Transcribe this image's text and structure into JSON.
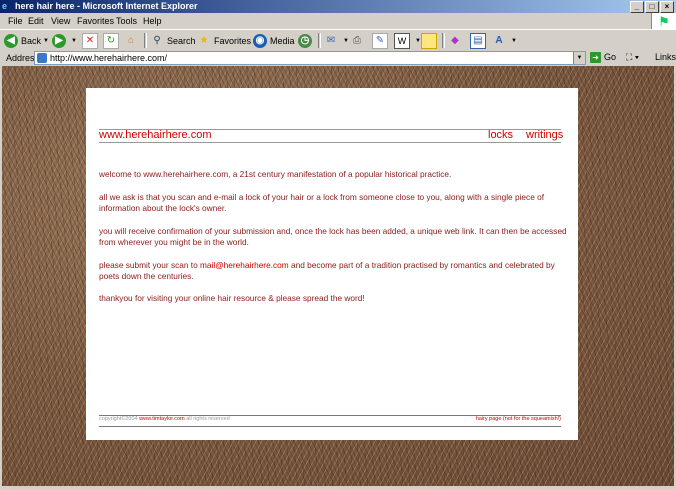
{
  "window": {
    "title": "here hair here - Microsoft Internet Explorer",
    "controls": [
      "_",
      "□",
      "×"
    ]
  },
  "menu": {
    "items": [
      "File",
      "Edit",
      "View",
      "Favorites",
      "Tools",
      "Help"
    ]
  },
  "toolbar": {
    "back_label": "Back",
    "search_label": "Search",
    "favorites_label": "Favorites",
    "media_label": "Media"
  },
  "address": {
    "label": "Address",
    "value": "http://www.herehairhere.com/",
    "go_label": "Go",
    "links_label": "Links"
  },
  "site": {
    "name": "www.herehairhere.com",
    "nav": [
      "locks",
      "writings"
    ],
    "paragraphs": {
      "p1": "welcome to www.herehairhere.com, a 21st century manifestation of a popular historical practice.",
      "p2": "all we ask is that you scan and e-mail a lock of your hair or a lock from someone close to you, along with a single piece of information about the lock's owner.",
      "p3": "you will receive confirmation of your submission and, once the lock has been added, a unique web link. It can then be accessed from wherever you might be in the world.",
      "p4_before": "please submit your scan to ",
      "p4_email": "mail@herehairhere.com",
      "p4_after": " and become part of a tradition practised by romantics and celebrated by poets down the centuries.",
      "p5": "thankyou for visiting your online hair resource & please spread the word!"
    },
    "footer": {
      "copyright": "copyright©2004 ",
      "credit_link": "www.timtaylor.com",
      "rights": " all rights reserved",
      "right_link": "hairy page (not for the squeamish!)"
    }
  },
  "colors": {
    "accent": "#cc0000",
    "body_text": "#8b1a1a",
    "titlebar_start": "#0a246a"
  }
}
